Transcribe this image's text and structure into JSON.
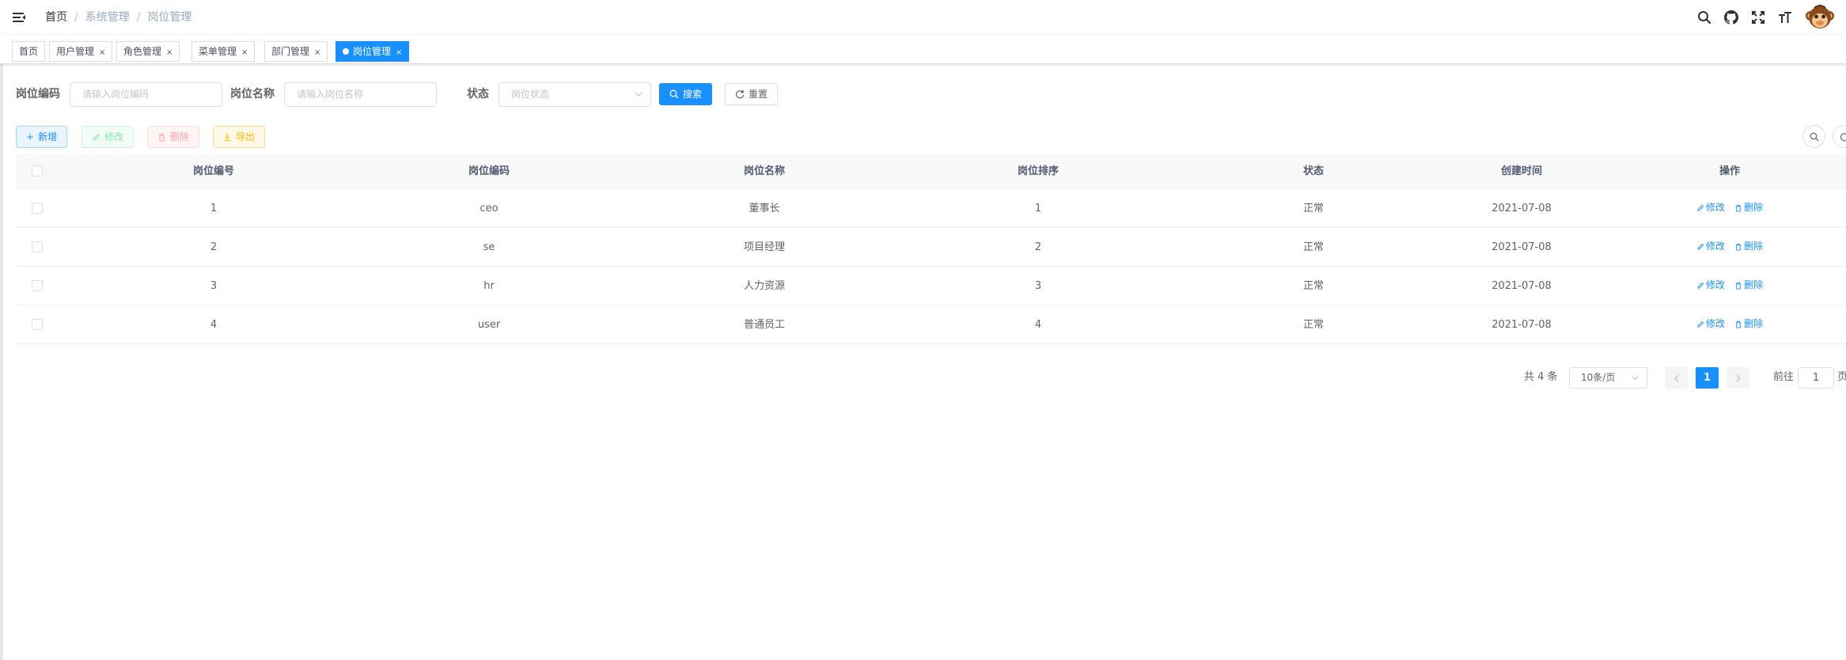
{
  "breadcrumb": {
    "home": "首页",
    "level1": "系统管理",
    "level2": "岗位管理"
  },
  "navbar": {
    "icons": [
      "search-icon",
      "github-icon",
      "fullscreen-icon",
      "font-size-icon"
    ]
  },
  "tags": [
    {
      "label": "首页",
      "closable": false,
      "active": false
    },
    {
      "label": "用户管理",
      "closable": true,
      "active": false
    },
    {
      "label": "角色管理",
      "closable": true,
      "active": false
    },
    {
      "label": "菜单管理",
      "closable": true,
      "active": false
    },
    {
      "label": "部门管理",
      "closable": true,
      "active": false
    },
    {
      "label": "岗位管理",
      "closable": true,
      "active": true
    }
  ],
  "tag_close": "×",
  "search": {
    "code_label": "岗位编码",
    "code_placeholder": "请输入岗位编码",
    "name_label": "岗位名称",
    "name_placeholder": "请输入岗位名称",
    "status_label": "状态",
    "status_placeholder": "岗位状态",
    "search_btn": "搜索",
    "reset_btn": "重置"
  },
  "toolbar": {
    "add": "新增",
    "edit": "修改",
    "delete": "删除",
    "export": "导出"
  },
  "table": {
    "headers": [
      "岗位编号",
      "岗位编码",
      "岗位名称",
      "岗位排序",
      "状态",
      "创建时间",
      "操作"
    ],
    "rows": [
      {
        "id": "1",
        "code": "ceo",
        "name": "董事长",
        "sort": "1",
        "status": "正常",
        "created": "2021-07-08"
      },
      {
        "id": "2",
        "code": "se",
        "name": "项目经理",
        "sort": "2",
        "status": "正常",
        "created": "2021-07-08"
      },
      {
        "id": "3",
        "code": "hr",
        "name": "人力资源",
        "sort": "3",
        "status": "正常",
        "created": "2021-07-08"
      },
      {
        "id": "4",
        "code": "user",
        "name": "普通员工",
        "sort": "4",
        "status": "正常",
        "created": "2021-07-08"
      }
    ],
    "op_edit": "修改",
    "op_delete": "删除"
  },
  "pagination": {
    "total": "共 4 条",
    "page_size": "10条/页",
    "current": "1",
    "jump_label": "前往",
    "jump_value": "1",
    "page_suffix": "页"
  },
  "colors": {
    "primary": "#1890ff",
    "success": "#13ce66",
    "danger": "#ff4949",
    "warning": "#ffba00"
  }
}
